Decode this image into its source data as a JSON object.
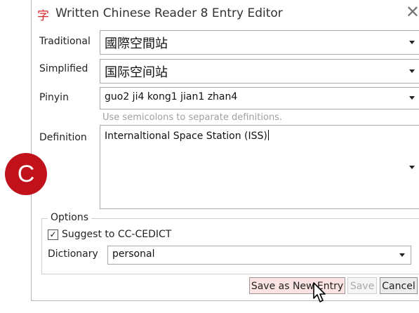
{
  "window": {
    "app_icon": "字",
    "title": "Written Chinese Reader 8 Entry Editor",
    "close_symbol": "✕"
  },
  "form": {
    "traditional_label": "Traditional",
    "traditional_value": "國際空間站",
    "simplified_label": "Simplified",
    "simplified_value": "国际空间站",
    "pinyin_label": "Pinyin",
    "pinyin_value": "guo2 ji4 kong1 jian1 zhan4",
    "definition_hint": "Use semicolons to separate definitions.",
    "definition_label": "Definition",
    "definition_value": "Internaltional Space Station (ISS)"
  },
  "options": {
    "title": "Options",
    "suggest_checked": true,
    "suggest_label": "Suggest to CC-CEDICT",
    "dictionary_label": "Dictionary",
    "dictionary_value": "personal"
  },
  "buttons": {
    "save_new": "Save as New Entry",
    "save": "Save",
    "cancel": "Cancel"
  },
  "overlay": {
    "badge_letter": "C",
    "badge_color": "#c1121c"
  },
  "icons": [
    "app-icon",
    "close-icon",
    "dropdown-caret-icon",
    "checkbox-check-icon",
    "mouse-pointer-icon"
  ]
}
